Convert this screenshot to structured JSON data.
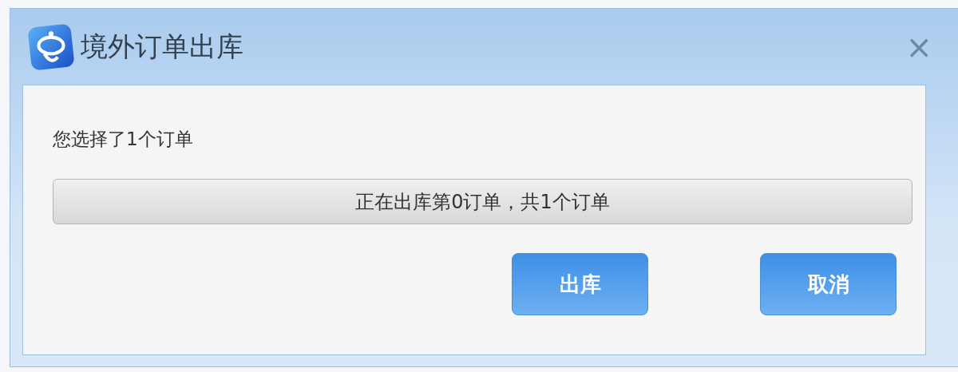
{
  "window": {
    "title": "境外订单出库",
    "close": "×"
  },
  "message": "您选择了1个订单",
  "progress": {
    "level": 0,
    "text": "正在出库第0订单，共1个订单"
  },
  "buttons": [
    {
      "label": "出库"
    },
    {
      "label": "取消"
    }
  ]
}
